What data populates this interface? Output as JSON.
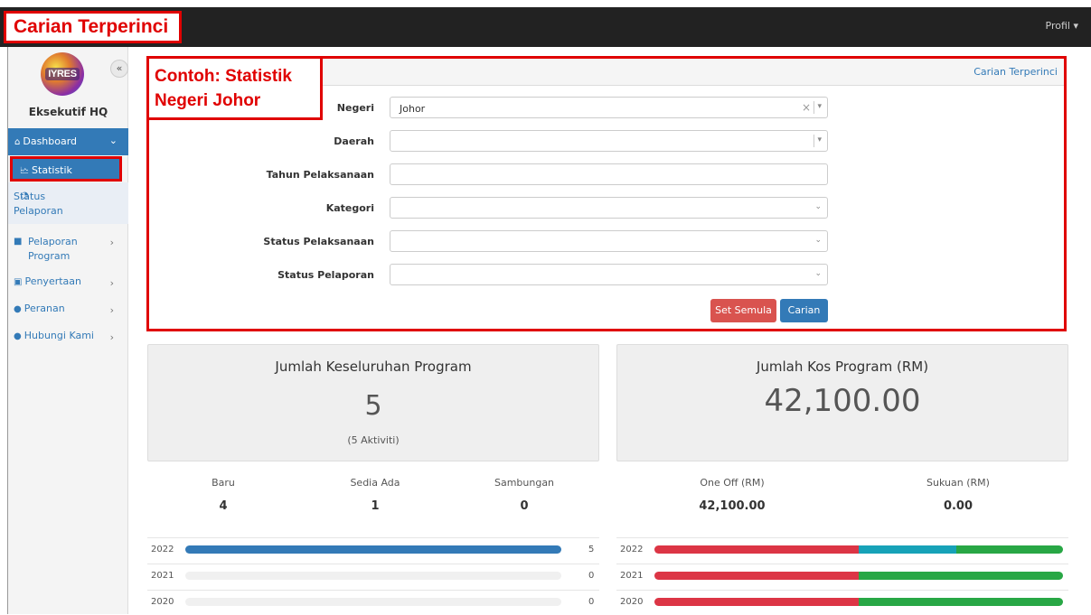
{
  "annotations": {
    "title": "Carian Terperinci",
    "example": "Contoh: Statistik Negeri Johor"
  },
  "topbar": {
    "profile_label": "Profil ▾"
  },
  "sidebar": {
    "logo_text": "IYRES",
    "collapse_icon": "«",
    "org_name": "Eksekutif HQ",
    "items": [
      {
        "label": "Dashboard",
        "icon": "home-icon"
      },
      {
        "label": "Statistik",
        "icon": "chart-line-icon"
      },
      {
        "label": "Status Pelaporan",
        "icon": "pie-chart-icon"
      },
      {
        "label": "Pelaporan Program",
        "icon": "book-icon"
      },
      {
        "label": "Penyertaan",
        "icon": "clipboard-icon"
      },
      {
        "label": "Peranan",
        "icon": "user-icon"
      },
      {
        "label": "Hubungi Kami",
        "icon": "chat-icon"
      }
    ]
  },
  "search": {
    "header_link": "Carian Terperinci",
    "fields": [
      {
        "label": "Negeri",
        "value": "Johor"
      },
      {
        "label": "Daerah",
        "value": ""
      },
      {
        "label": "Tahun Pelaksanaan",
        "value": ""
      },
      {
        "label": "Kategori",
        "value": ""
      },
      {
        "label": "Status Pelaksanaan",
        "value": ""
      },
      {
        "label": "Status Pelaporan",
        "value": ""
      }
    ],
    "reset_label": "Set Semula",
    "search_label": "Carian"
  },
  "summary": {
    "program": {
      "title": "Jumlah Keseluruhan Program",
      "value": "5",
      "sub": "(5 Aktiviti)"
    },
    "cost": {
      "title": "Jumlah Kos Program (RM)",
      "value": "42,100.00"
    }
  },
  "program_breakdown": [
    {
      "label": "Baru",
      "value": "4"
    },
    {
      "label": "Sedia Ada",
      "value": "1"
    },
    {
      "label": "Sambungan",
      "value": "0"
    }
  ],
  "cost_breakdown": [
    {
      "label": "One Off (RM)",
      "value": "42,100.00"
    },
    {
      "label": "Sukuan (RM)",
      "value": "0.00"
    }
  ],
  "program_years": [
    {
      "year": "2022",
      "count": "5",
      "fraction": 1.0
    },
    {
      "year": "2021",
      "count": "0",
      "fraction": 0.0
    },
    {
      "year": "2020",
      "count": "0",
      "fraction": 0.0
    }
  ],
  "cost_years": [
    {
      "year": "2022",
      "segments": [
        0.5,
        0.24,
        0.26
      ]
    },
    {
      "year": "2021",
      "segments": [
        0.5,
        0.0,
        0.5
      ]
    },
    {
      "year": "2020",
      "segments": [
        0.5,
        0.0,
        0.5
      ]
    }
  ],
  "colors": {
    "primary": "#337ab7",
    "danger": "#d9534f",
    "red": "#dc3545",
    "teal": "#17a2b8",
    "green": "#28a745",
    "annotation": "#e00000"
  }
}
